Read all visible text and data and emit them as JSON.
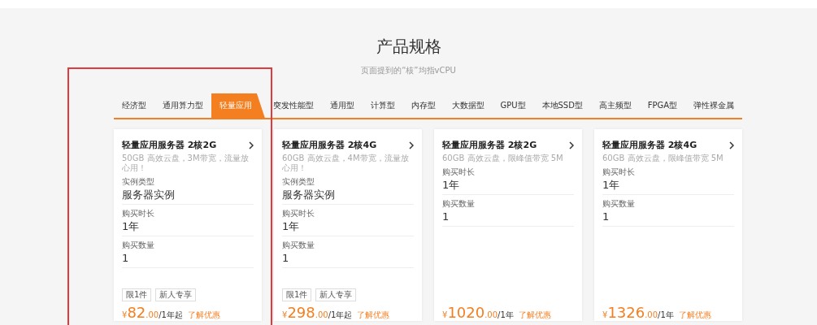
{
  "title": "产品规格",
  "subtitle": "页面提到的“核”均指vCPU",
  "tabs": [
    {
      "label": "经济型",
      "selected": false
    },
    {
      "label": "通用算力型",
      "selected": false
    },
    {
      "label": "轻量应用",
      "selected": true
    },
    {
      "label": "突发性能型",
      "selected": false
    },
    {
      "label": "通用型",
      "selected": false
    },
    {
      "label": "计算型",
      "selected": false
    },
    {
      "label": "内存型",
      "selected": false
    },
    {
      "label": "大数据型",
      "selected": false
    },
    {
      "label": "GPU型",
      "selected": false
    },
    {
      "label": "本地SSD型",
      "selected": false
    },
    {
      "label": "高主频型",
      "selected": false
    },
    {
      "label": "FPGA型",
      "selected": false
    },
    {
      "label": "弹性裸金属",
      "selected": false
    }
  ],
  "cards": [
    {
      "name": "轻量应用服务器 2核2G",
      "desc": "50GB 高效云盘，3M带宽，流量放心用！",
      "fields": [
        {
          "label": "实例类型",
          "value": "服务器实例"
        },
        {
          "label": "购买时长",
          "value": "1年"
        },
        {
          "label": "购买数量",
          "value": "1"
        }
      ],
      "tags": [
        "限1件",
        "新人专享"
      ],
      "currency": "¥",
      "price": "82",
      "decimals": ".00",
      "unit": "/1年起",
      "offer_link": "了解优惠"
    },
    {
      "name": "轻量应用服务器 2核4G",
      "desc": "60GB 高效云盘，4M带宽，流量放心用！",
      "fields": [
        {
          "label": "实例类型",
          "value": "服务器实例"
        },
        {
          "label": "购买时长",
          "value": "1年"
        },
        {
          "label": "购买数量",
          "value": "1"
        }
      ],
      "tags": [
        "限1件",
        "新人专享"
      ],
      "currency": "¥",
      "price": "298",
      "decimals": ".00",
      "unit": "/1年起",
      "offer_link": "了解优惠"
    },
    {
      "name": "轻量应用服务器 2核2G",
      "desc": "60GB 高效云盘，限峰值带宽 5M",
      "fields": [
        {
          "label": "购买时长",
          "value": "1年"
        },
        {
          "label": "购买数量",
          "value": "1"
        }
      ],
      "currency": "¥",
      "price": "1020",
      "decimals": ".00",
      "unit": "/1年",
      "offer_link": "了解优惠"
    },
    {
      "name": "轻量应用服务器 2核4G",
      "desc": "60GB 高效云盘，限峰值带宽 5M",
      "fields": [
        {
          "label": "购买时长",
          "value": "1年"
        },
        {
          "label": "购买数量",
          "value": "1"
        }
      ],
      "currency": "¥",
      "price": "1326",
      "decimals": ".00",
      "unit": "/1年",
      "offer_link": "了解优惠"
    }
  ]
}
